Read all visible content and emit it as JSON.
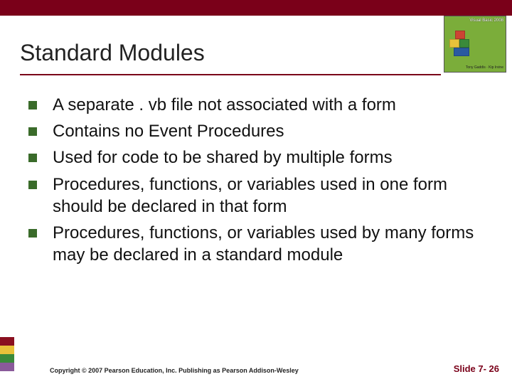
{
  "title": "Standard Modules",
  "brand": {
    "product": "Visual Basic 2008",
    "author": "Tony Gaddis · Kip Irvine"
  },
  "bullets": [
    "A separate . vb file not associated with a form",
    "Contains no Event Procedures",
    "Used for code to be shared by multiple forms",
    "Procedures, functions, or variables used in one form should be declared in that form",
    "Procedures, functions, or variables used by many forms may be declared in a standard module"
  ],
  "footer": {
    "copyright": "Copyright © 2007 Pearson Education, Inc. Publishing as Pearson Addison-Wesley",
    "slide_label": "Slide 7- 26"
  }
}
